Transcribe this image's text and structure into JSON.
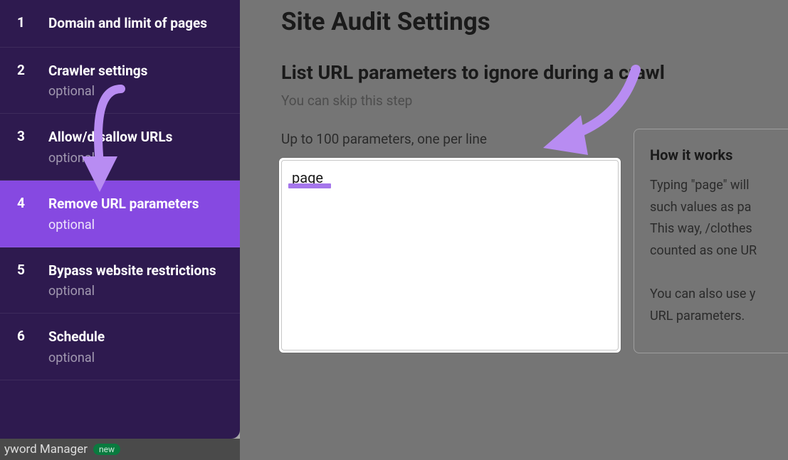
{
  "sidebar": {
    "items": [
      {
        "num": "1",
        "label": "Domain and limit of pages",
        "sub": ""
      },
      {
        "num": "2",
        "label": "Crawler settings",
        "sub": "optional"
      },
      {
        "num": "3",
        "label": "Allow/disallow URLs",
        "sub": "optional"
      },
      {
        "num": "4",
        "label": "Remove URL parameters",
        "sub": "optional"
      },
      {
        "num": "5",
        "label": "Bypass website restrictions",
        "sub": "optional"
      },
      {
        "num": "6",
        "label": "Schedule",
        "sub": "optional"
      }
    ]
  },
  "bottom": {
    "label": "yword Manager",
    "badge": "new"
  },
  "main": {
    "title": "Site Audit Settings",
    "subheading": "List URL parameters to ignore during a crawl",
    "skip": "You can skip this step",
    "limit": "Up to 100 parameters, one per line",
    "textarea_value": "page"
  },
  "info": {
    "title": "How it works",
    "body": "Typing \"page\" will\nsuch values as pa\nThis way, /clothes\ncounted as one UR\n\nYou can also use y\nURL parameters."
  }
}
